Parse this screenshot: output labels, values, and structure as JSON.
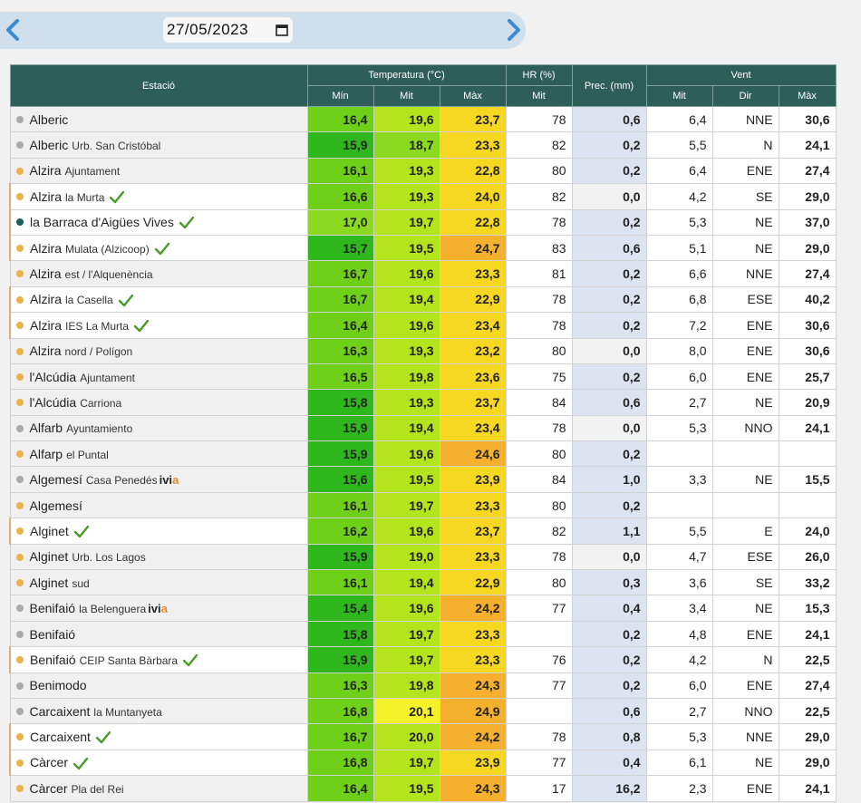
{
  "date_value": "27/05/2023",
  "colors": {
    "header_bg": "#2e5e5a",
    "dot_yellow": "#e9b24a",
    "dot_gray": "#aaaaaa",
    "dot_teal": "#1d5f5d",
    "check_green": "#4a9a2a"
  },
  "headers": {
    "estacio": "Estació",
    "temperatura": "Temperatura (°C)",
    "hr": "HR (%)",
    "prec": "Prec. (mm)",
    "vent": "Vent",
    "min": "Mín",
    "mit": "Mit",
    "max": "Màx",
    "hr_mit": "Mit",
    "vent_mit": "Mit",
    "vent_dir": "Dir",
    "vent_max": "Màx"
  },
  "rows": [
    {
      "name": "Alberic",
      "sub": "",
      "dot": "gray",
      "check": false,
      "ivia": false,
      "white": false,
      "min": "16,4",
      "mit": "19,6",
      "max": "23,7",
      "hr": "78",
      "prec": "0,6",
      "vmit": "6,4",
      "vdir": "NNE",
      "vmax": "30,6",
      "cmin": "#6fd01a",
      "cmit": "#b3e41c",
      "cmax": "#f6d722",
      "pz": false
    },
    {
      "name": "Alberic",
      "sub": "Urb. San Cristóbal",
      "dot": "gray",
      "check": false,
      "ivia": false,
      "white": false,
      "min": "15,9",
      "mit": "18,7",
      "max": "23,3",
      "hr": "82",
      "prec": "0,2",
      "vmit": "5,5",
      "vdir": "N",
      "vmax": "24,1",
      "cmin": "#2fb81d",
      "cmit": "#8bda1f",
      "cmax": "#f6d722",
      "pz": false
    },
    {
      "name": "Alzira",
      "sub": "Ajuntament",
      "dot": "yellow",
      "check": false,
      "ivia": false,
      "white": false,
      "min": "16,1",
      "mit": "19,3",
      "max": "22,8",
      "hr": "80",
      "prec": "0,2",
      "vmit": "6,4",
      "vdir": "ENE",
      "vmax": "27,4",
      "cmin": "#6fd01a",
      "cmit": "#b3e41c",
      "cmax": "#f6d722",
      "pz": false
    },
    {
      "name": "Alzira",
      "sub": "la Murta",
      "dot": "yellow",
      "check": true,
      "ivia": false,
      "white": true,
      "min": "16,6",
      "mit": "19,3",
      "max": "24,0",
      "hr": "82",
      "prec": "0,0",
      "vmit": "4,2",
      "vdir": "SE",
      "vmax": "29,0",
      "cmin": "#6fd01a",
      "cmit": "#b3e41c",
      "cmax": "#f6d722",
      "pz": true
    },
    {
      "name": "la Barraca d'Aigües Vives",
      "sub": "",
      "dot": "teal",
      "check": true,
      "ivia": false,
      "white": true,
      "min": "17,0",
      "mit": "19,7",
      "max": "22,8",
      "hr": "78",
      "prec": "0,2",
      "vmit": "5,3",
      "vdir": "NE",
      "vmax": "37,0",
      "cmin": "#8bda1f",
      "cmit": "#b3e41c",
      "cmax": "#f6d722",
      "pz": false
    },
    {
      "name": "Alzira",
      "sub": "Mulata (Alzicoop)",
      "dot": "yellow",
      "check": true,
      "ivia": false,
      "white": true,
      "min": "15,7",
      "mit": "19,5",
      "max": "24,7",
      "hr": "83",
      "prec": "0,6",
      "vmit": "5,1",
      "vdir": "NE",
      "vmax": "29,0",
      "cmin": "#2fb81d",
      "cmit": "#b3e41c",
      "cmax": "#f5b12e",
      "pz": false
    },
    {
      "name": "Alzira",
      "sub": "est / l'Alquenència",
      "dot": "yellow",
      "check": false,
      "ivia": false,
      "white": false,
      "min": "16,7",
      "mit": "19,6",
      "max": "23,3",
      "hr": "81",
      "prec": "0,2",
      "vmit": "6,6",
      "vdir": "NNE",
      "vmax": "27,4",
      "cmin": "#6fd01a",
      "cmit": "#b3e41c",
      "cmax": "#f6d722",
      "pz": false
    },
    {
      "name": "Alzira",
      "sub": "la Casella",
      "dot": "yellow",
      "check": true,
      "ivia": false,
      "white": true,
      "min": "16,7",
      "mit": "19,4",
      "max": "22,9",
      "hr": "78",
      "prec": "0,2",
      "vmit": "6,8",
      "vdir": "ESE",
      "vmax": "40,2",
      "cmin": "#6fd01a",
      "cmit": "#b3e41c",
      "cmax": "#f6d722",
      "pz": false
    },
    {
      "name": "Alzira",
      "sub": "IES La Murta",
      "dot": "yellow",
      "check": true,
      "ivia": false,
      "white": true,
      "min": "16,4",
      "mit": "19,6",
      "max": "23,4",
      "hr": "78",
      "prec": "0,2",
      "vmit": "7,2",
      "vdir": "ENE",
      "vmax": "30,6",
      "cmin": "#6fd01a",
      "cmit": "#b3e41c",
      "cmax": "#f6d722",
      "pz": false
    },
    {
      "name": "Alzira",
      "sub": "nord / Polígon",
      "dot": "yellow",
      "check": false,
      "ivia": false,
      "white": false,
      "min": "16,3",
      "mit": "19,3",
      "max": "23,2",
      "hr": "80",
      "prec": "0,0",
      "vmit": "8,0",
      "vdir": "ENE",
      "vmax": "30,6",
      "cmin": "#6fd01a",
      "cmit": "#b3e41c",
      "cmax": "#f6d722",
      "pz": true
    },
    {
      "name": "l'Alcúdia",
      "sub": "Ajuntament",
      "dot": "yellow",
      "check": false,
      "ivia": false,
      "white": false,
      "min": "16,5",
      "mit": "19,8",
      "max": "23,6",
      "hr": "75",
      "prec": "0,2",
      "vmit": "6,0",
      "vdir": "ENE",
      "vmax": "25,7",
      "cmin": "#6fd01a",
      "cmit": "#b3e41c",
      "cmax": "#f6d722",
      "pz": false
    },
    {
      "name": "l'Alcúdia",
      "sub": "Carriona",
      "dot": "yellow",
      "check": false,
      "ivia": false,
      "white": false,
      "min": "15,8",
      "mit": "19,3",
      "max": "23,7",
      "hr": "84",
      "prec": "0,6",
      "vmit": "2,7",
      "vdir": "NE",
      "vmax": "20,9",
      "cmin": "#2fb81d",
      "cmit": "#b3e41c",
      "cmax": "#f6d722",
      "pz": false
    },
    {
      "name": "Alfarb",
      "sub": "Ayuntamiento",
      "dot": "gray",
      "check": false,
      "ivia": false,
      "white": false,
      "min": "15,9",
      "mit": "19,4",
      "max": "23,4",
      "hr": "78",
      "prec": "0,0",
      "vmit": "5,3",
      "vdir": "NNO",
      "vmax": "24,1",
      "cmin": "#2fb81d",
      "cmit": "#b3e41c",
      "cmax": "#f6d722",
      "pz": true
    },
    {
      "name": "Alfarp",
      "sub": "el Puntal",
      "dot": "yellow",
      "check": false,
      "ivia": false,
      "white": false,
      "min": "15,9",
      "mit": "19,6",
      "max": "24,6",
      "hr": "80",
      "prec": "0,2",
      "vmit": "",
      "vdir": "",
      "vmax": "",
      "cmin": "#2fb81d",
      "cmit": "#b3e41c",
      "cmax": "#f5b12e",
      "pz": false
    },
    {
      "name": "Algemesí",
      "sub": "Casa Penedés",
      "dot": "gray",
      "check": false,
      "ivia": true,
      "white": false,
      "min": "15,6",
      "mit": "19,5",
      "max": "23,9",
      "hr": "84",
      "prec": "1,0",
      "vmit": "3,3",
      "vdir": "NE",
      "vmax": "15,5",
      "cmin": "#2fb81d",
      "cmit": "#b3e41c",
      "cmax": "#f6d722",
      "pz": false
    },
    {
      "name": "Algemesí",
      "sub": "",
      "dot": "yellow",
      "check": false,
      "ivia": false,
      "white": false,
      "min": "16,1",
      "mit": "19,7",
      "max": "23,3",
      "hr": "80",
      "prec": "0,2",
      "vmit": "",
      "vdir": "",
      "vmax": "",
      "cmin": "#6fd01a",
      "cmit": "#b3e41c",
      "cmax": "#f6d722",
      "pz": false
    },
    {
      "name": "Alginet",
      "sub": "",
      "dot": "yellow",
      "check": true,
      "ivia": false,
      "white": true,
      "min": "16,2",
      "mit": "19,6",
      "max": "23,7",
      "hr": "82",
      "prec": "1,1",
      "vmit": "5,5",
      "vdir": "E",
      "vmax": "24,0",
      "cmin": "#6fd01a",
      "cmit": "#b3e41c",
      "cmax": "#f6d722",
      "pz": false
    },
    {
      "name": "Alginet",
      "sub": "Urb. Los Lagos",
      "dot": "yellow",
      "check": false,
      "ivia": false,
      "white": false,
      "min": "15,9",
      "mit": "19,0",
      "max": "23,3",
      "hr": "78",
      "prec": "0,0",
      "vmit": "4,7",
      "vdir": "ESE",
      "vmax": "26,0",
      "cmin": "#2fb81d",
      "cmit": "#b3e41c",
      "cmax": "#f6d722",
      "pz": true
    },
    {
      "name": "Alginet",
      "sub": "sud",
      "dot": "yellow",
      "check": false,
      "ivia": false,
      "white": false,
      "min": "16,1",
      "mit": "19,4",
      "max": "22,9",
      "hr": "80",
      "prec": "0,3",
      "vmit": "3,6",
      "vdir": "SE",
      "vmax": "33,2",
      "cmin": "#6fd01a",
      "cmit": "#b3e41c",
      "cmax": "#f6d722",
      "pz": false
    },
    {
      "name": "Benifaió",
      "sub": "la Belenguera",
      "dot": "gray",
      "check": false,
      "ivia": true,
      "white": false,
      "min": "15,4",
      "mit": "19,6",
      "max": "24,2",
      "hr": "77",
      "prec": "0,4",
      "vmit": "3,4",
      "vdir": "NE",
      "vmax": "15,3",
      "cmin": "#2fb81d",
      "cmit": "#b3e41c",
      "cmax": "#f5b12e",
      "pz": false
    },
    {
      "name": "Benifaió",
      "sub": "",
      "dot": "gray",
      "check": false,
      "ivia": false,
      "white": false,
      "min": "15,8",
      "mit": "19,7",
      "max": "23,3",
      "hr": "",
      "prec": "0,2",
      "vmit": "4,8",
      "vdir": "ENE",
      "vmax": "24,1",
      "cmin": "#2fb81d",
      "cmit": "#b3e41c",
      "cmax": "#f6d722",
      "pz": false
    },
    {
      "name": "Benifaió",
      "sub": "CEIP Santa Bàrbara",
      "dot": "yellow",
      "check": true,
      "ivia": false,
      "white": true,
      "min": "15,9",
      "mit": "19,7",
      "max": "23,3",
      "hr": "76",
      "prec": "0,2",
      "vmit": "4,2",
      "vdir": "N",
      "vmax": "22,5",
      "cmin": "#2fb81d",
      "cmit": "#b3e41c",
      "cmax": "#f6d722",
      "pz": false
    },
    {
      "name": "Benimodo",
      "sub": "",
      "dot": "gray",
      "check": false,
      "ivia": false,
      "white": false,
      "min": "16,3",
      "mit": "19,8",
      "max": "24,3",
      "hr": "77",
      "prec": "0,2",
      "vmit": "6,0",
      "vdir": "ENE",
      "vmax": "27,4",
      "cmin": "#6fd01a",
      "cmit": "#b3e41c",
      "cmax": "#f5b12e",
      "pz": false
    },
    {
      "name": "Carcaixent",
      "sub": "la Muntanyeta",
      "dot": "gray",
      "check": false,
      "ivia": false,
      "white": false,
      "min": "16,8",
      "mit": "20,1",
      "max": "24,9",
      "hr": "",
      "prec": "0,6",
      "vmit": "2,7",
      "vdir": "NNO",
      "vmax": "22,5",
      "cmin": "#6fd01a",
      "cmit": "#f6f22a",
      "cmax": "#f5b12e",
      "pz": false
    },
    {
      "name": "Carcaixent",
      "sub": "",
      "dot": "yellow",
      "check": true,
      "ivia": false,
      "white": true,
      "min": "16,7",
      "mit": "20,0",
      "max": "24,2",
      "hr": "78",
      "prec": "0,8",
      "vmit": "5,3",
      "vdir": "NNE",
      "vmax": "29,0",
      "cmin": "#6fd01a",
      "cmit": "#b3e41c",
      "cmax": "#f5b12e",
      "pz": false
    },
    {
      "name": "Càrcer",
      "sub": "",
      "dot": "yellow",
      "check": true,
      "ivia": false,
      "white": true,
      "min": "16,8",
      "mit": "19,7",
      "max": "23,9",
      "hr": "77",
      "prec": "0,4",
      "vmit": "6,1",
      "vdir": "NE",
      "vmax": "29,0",
      "cmin": "#6fd01a",
      "cmit": "#b3e41c",
      "cmax": "#f6d722",
      "pz": false
    },
    {
      "name": "Càrcer",
      "sub": "Pla del Rei",
      "dot": "yellow",
      "check": false,
      "ivia": false,
      "white": false,
      "min": "16,4",
      "mit": "19,5",
      "max": "24,3",
      "hr": "17",
      "prec": "16,2",
      "vmit": "2,3",
      "vdir": "ENE",
      "vmax": "24,1",
      "cmin": "#6fd01a",
      "cmit": "#b3e41c",
      "cmax": "#f5b12e",
      "pz": false
    }
  ],
  "ivia_text": "ivi",
  "ivia_tail": "a"
}
